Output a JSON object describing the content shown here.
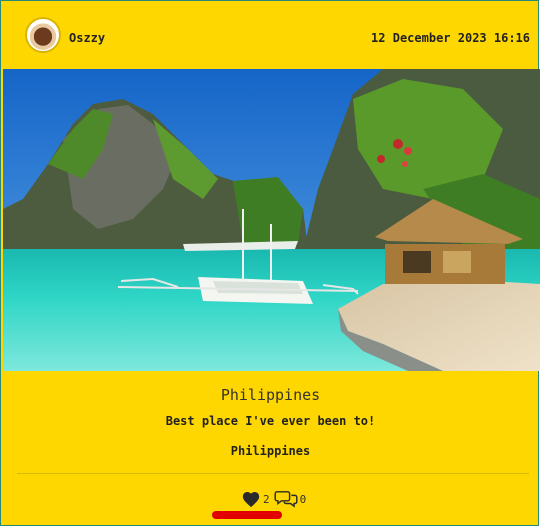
{
  "post": {
    "username": "Oszzy",
    "timestamp": "12 December 2023 16:16",
    "title": "Philippines",
    "caption": "Best place I've ever been to!",
    "location": "Philippines",
    "likes": "2",
    "comments": "0"
  },
  "icons": {
    "like": "heart-icon",
    "comment": "comment-bubbles-icon"
  },
  "colors": {
    "card_background": "#ffd700",
    "card_border": "#2a8a7a",
    "highlight": "#e00000"
  }
}
